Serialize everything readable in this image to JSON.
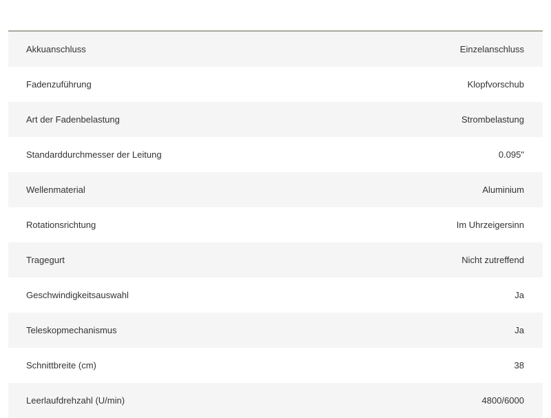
{
  "specs": {
    "rows": [
      {
        "label": "Akkuanschluss",
        "value": "Einzelanschluss"
      },
      {
        "label": "Fadenzuführung",
        "value": "Klopfvorschub"
      },
      {
        "label": "Art der Fadenbelastung",
        "value": "Strombelastung"
      },
      {
        "label": "Standarddurchmesser der Leitung",
        "value": "0.095\""
      },
      {
        "label": "Wellenmaterial",
        "value": "Aluminium"
      },
      {
        "label": "Rotationsrichtung",
        "value": "Im Uhrzeigersinn"
      },
      {
        "label": "Tragegurt",
        "value": "Nicht zutreffend"
      },
      {
        "label": "Geschwindigkeitsauswahl",
        "value": "Ja"
      },
      {
        "label": "Teleskopmechanismus",
        "value": "Ja"
      },
      {
        "label": "Schnittbreite (cm)",
        "value": "38"
      },
      {
        "label": "Leerlaufdrehzahl (U/min)",
        "value": "4800/6000"
      }
    ]
  }
}
